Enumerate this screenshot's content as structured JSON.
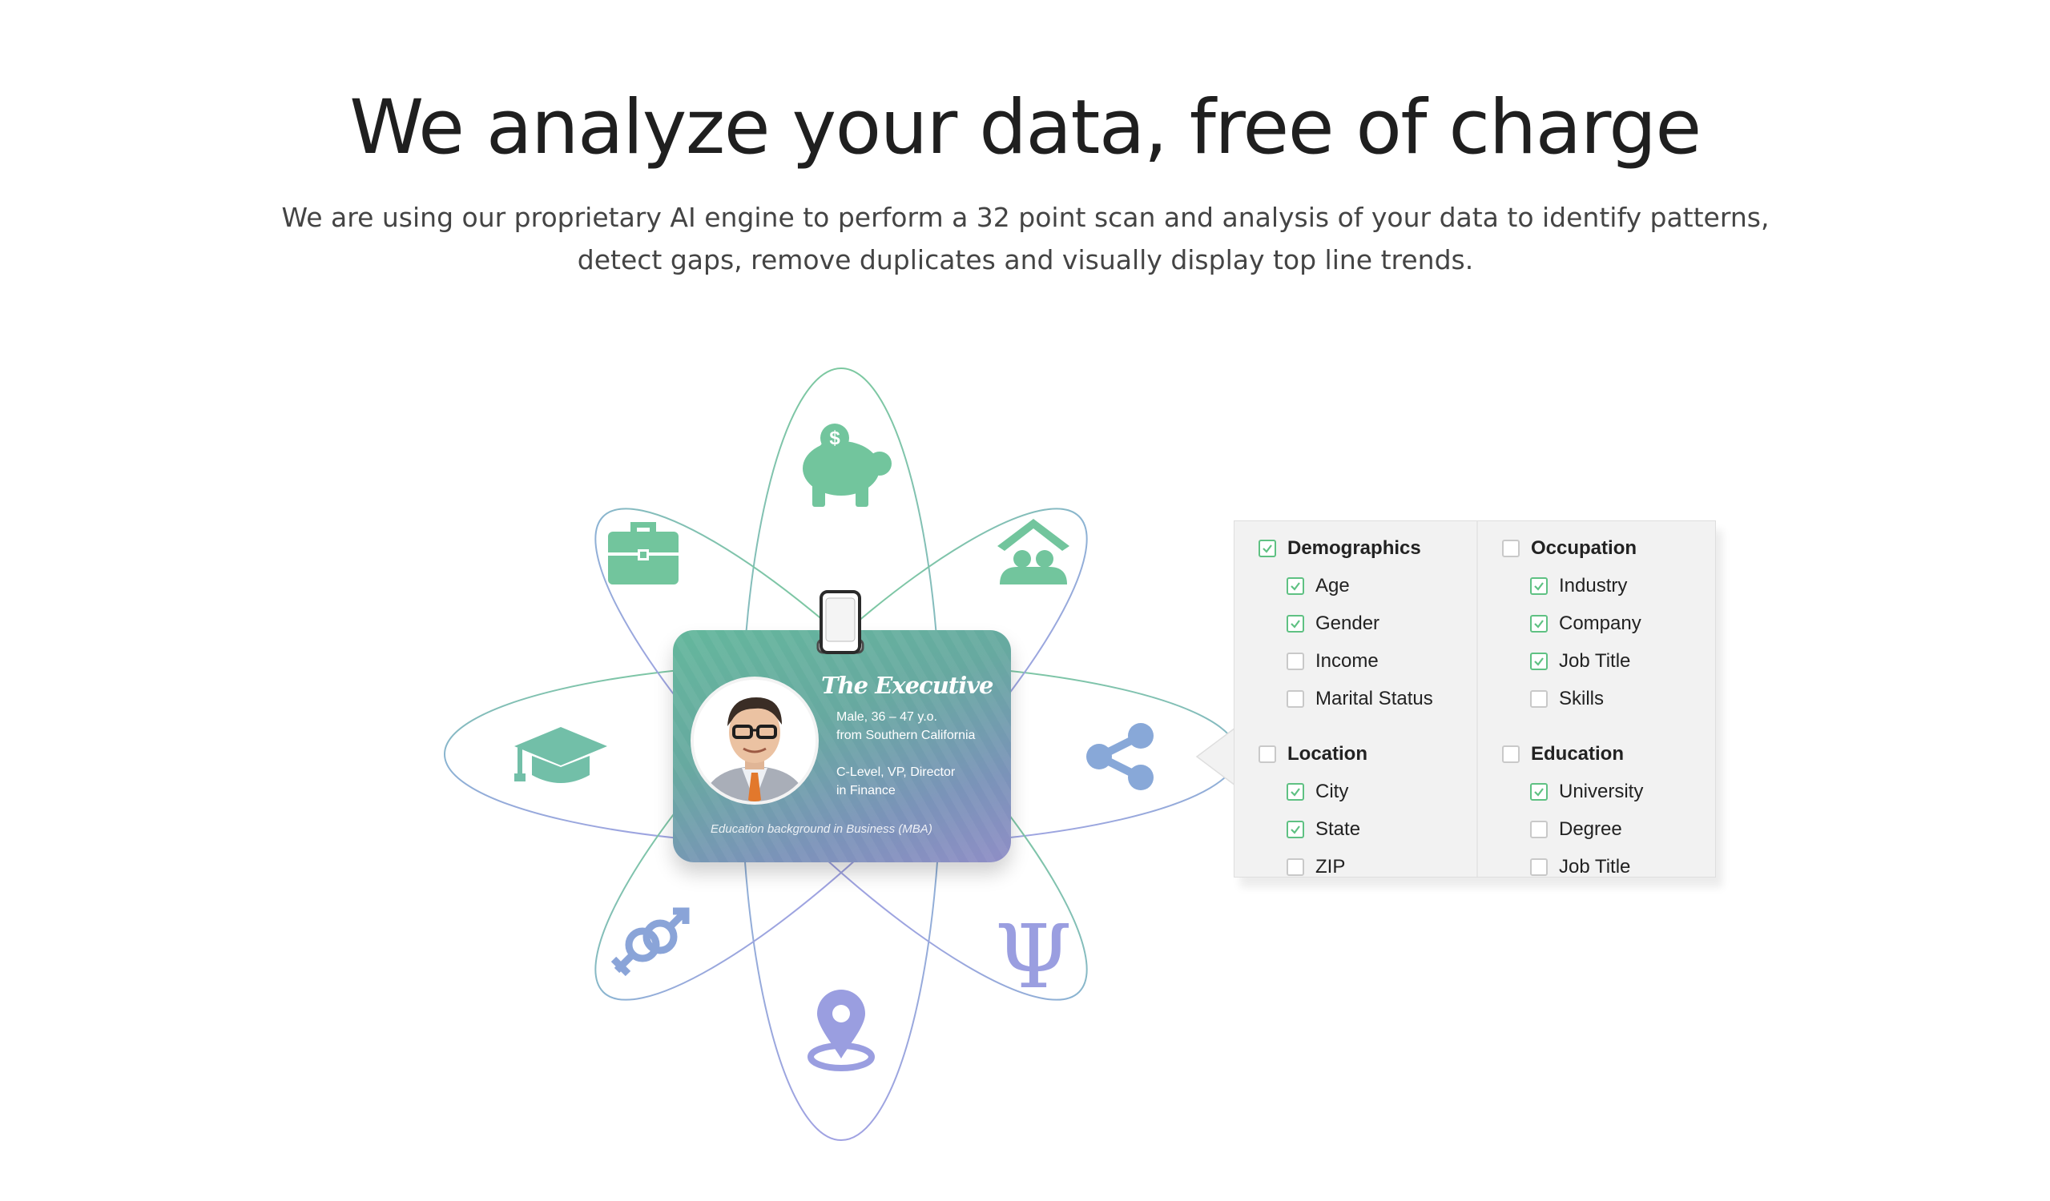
{
  "headline": "We analyze your data, free of charge",
  "subhead": {
    "line1": "We are using our proprietary AI engine to perform a 32 point scan and analysis of your data to identify patterns,",
    "line2": "detect gaps, remove duplicates and visually display top line trends."
  },
  "badge": {
    "title": "The Executive",
    "line1": "Male, 36 – 47 y.o.",
    "line2": "from Southern California",
    "line3": "C-Level, VP, Director",
    "line4": "in Finance",
    "education": "Education background in Business (MBA)"
  },
  "icons": [
    "piggy-bank-icon",
    "home-family-icon",
    "share-icon",
    "psi-icon",
    "location-pin-icon",
    "gender-icon",
    "graduation-cap-icon",
    "briefcase-icon"
  ],
  "colors": {
    "green": "#6fc39a",
    "blue": "#88a8d8",
    "purple": "#9a9ee0",
    "check": "#5fc183"
  },
  "panel": {
    "left": [
      {
        "label": "Demographics",
        "checked": true,
        "items": [
          {
            "label": "Age",
            "checked": true
          },
          {
            "label": "Gender",
            "checked": true
          },
          {
            "label": "Income",
            "checked": false
          },
          {
            "label": "Marital Status",
            "checked": false
          }
        ]
      },
      {
        "label": "Location",
        "checked": false,
        "items": [
          {
            "label": "City",
            "checked": true
          },
          {
            "label": "State",
            "checked": true
          },
          {
            "label": "ZIP",
            "checked": false
          }
        ]
      }
    ],
    "right": [
      {
        "label": "Occupation",
        "checked": false,
        "items": [
          {
            "label": "Industry",
            "checked": true
          },
          {
            "label": "Company",
            "checked": true
          },
          {
            "label": "Job Title",
            "checked": true
          },
          {
            "label": "Skills",
            "checked": false
          }
        ]
      },
      {
        "label": "Education",
        "checked": false,
        "items": [
          {
            "label": "University",
            "checked": true
          },
          {
            "label": "Degree",
            "checked": false
          },
          {
            "label": "Job Title",
            "checked": false
          }
        ]
      }
    ]
  }
}
